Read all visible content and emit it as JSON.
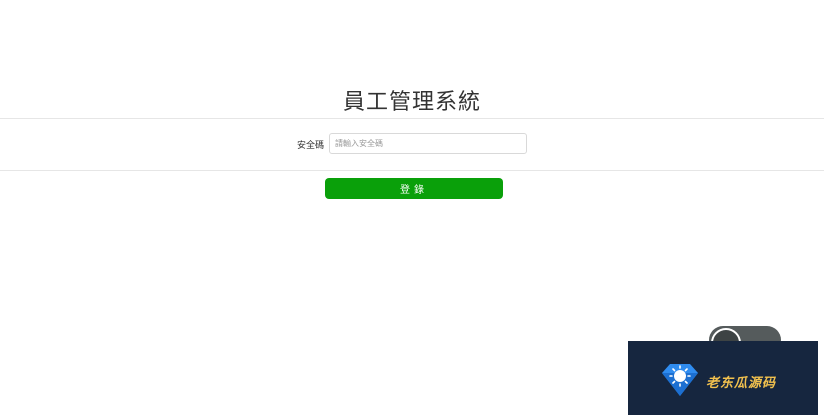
{
  "page": {
    "title": "員工管理系統"
  },
  "form": {
    "security_code_label": "安全碼",
    "security_code_placeholder": "請輸入安全碼",
    "security_code_value": "",
    "login_label": "登錄"
  },
  "overlay": {
    "chat_label": "",
    "watermark_text": "老东瓜源码",
    "watermark_icon": "diamond-sun-icon"
  },
  "colors": {
    "login_button": "#0aa00a",
    "watermark_bg": "#16263f",
    "watermark_text": "#f2c14e",
    "logo_blue": "#2f8cf0"
  }
}
